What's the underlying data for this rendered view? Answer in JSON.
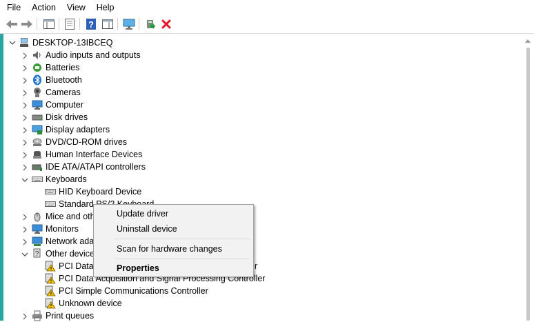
{
  "menubar": {
    "items": [
      "File",
      "Action",
      "View",
      "Help"
    ]
  },
  "toolbar": {
    "buttons": [
      "back-icon",
      "forward-icon",
      "show-hide-console-tree-icon",
      "properties-icon",
      "help-icon",
      "action-pane-icon",
      "display-monitor-icon",
      "update-driver-icon",
      "uninstall-icon"
    ],
    "colors": {
      "uninstall": "#e81123",
      "help": "#2b5fb8"
    }
  },
  "tree": {
    "root": "DESKTOP-13IBCEQ",
    "categories": {
      "audio": "Audio inputs and outputs",
      "batteries": "Batteries",
      "bluetooth": "Bluetooth",
      "cameras": "Cameras",
      "computer": "Computer",
      "disk": "Disk drives",
      "display": "Display adapters",
      "dvd": "DVD/CD-ROM drives",
      "hid": "Human Interface Devices",
      "ide": "IDE ATA/ATAPI controllers",
      "keyboards": "Keyboards",
      "mice": "Mice and oth",
      "monitors": "Monitors",
      "network": "Network ada",
      "other": "Other device",
      "print": "Print queues"
    },
    "keyboards_children": [
      "HID Keyboard Device",
      "Standard PS/2 Keyboard"
    ],
    "other_children": [
      "PCI Data",
      "PCI Data Acquisition and Signal Processing Controller",
      "PCI Simple Communications Controller",
      "Unknown device"
    ],
    "other_first_visible_tail": "r"
  },
  "context_menu": {
    "update": "Update driver",
    "uninstall": "Uninstall device",
    "scan": "Scan for hardware changes",
    "properties": "Properties"
  },
  "colors": {
    "accent_strip": "#2aa3a3",
    "warning": "#f2c200",
    "menu_bg": "#f2f2f2"
  }
}
